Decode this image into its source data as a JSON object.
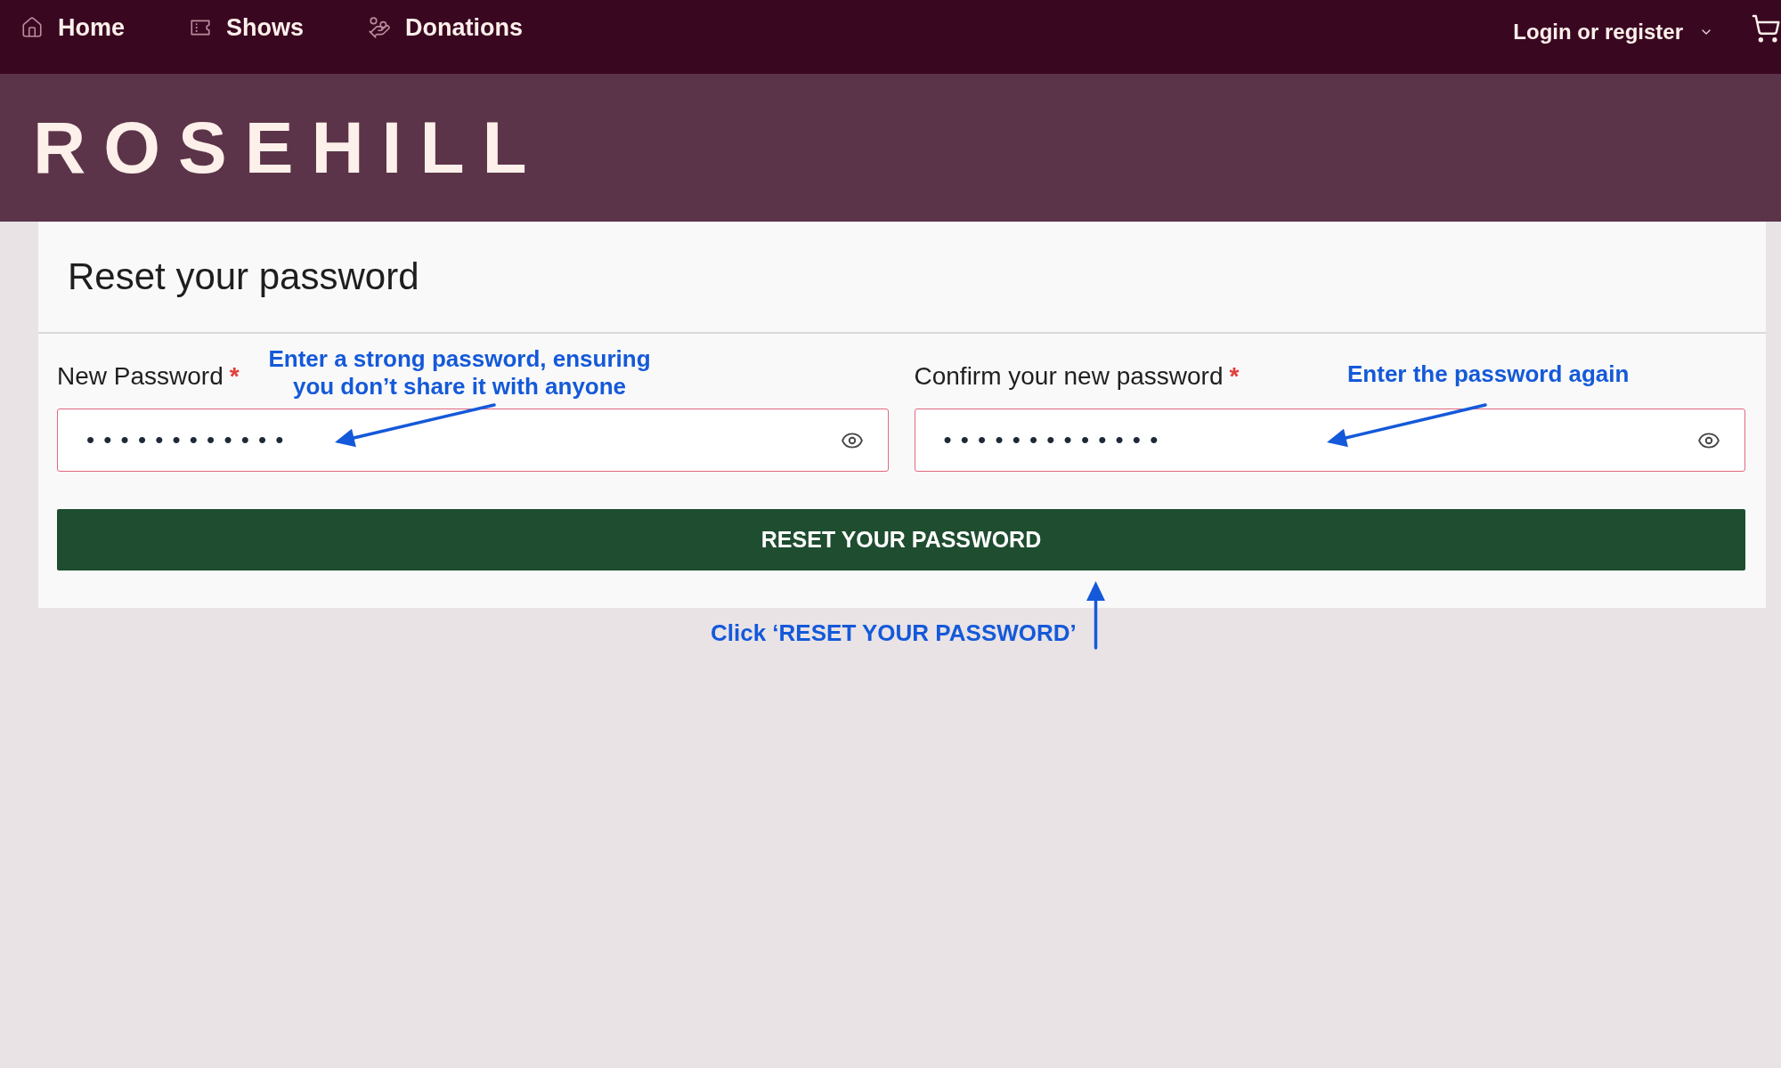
{
  "nav": {
    "items": [
      {
        "label": "Home"
      },
      {
        "label": "Shows"
      },
      {
        "label": "Donations"
      }
    ],
    "account_menu": {
      "label": "Login or register"
    }
  },
  "banner": {
    "logo": "ROSEHILL"
  },
  "form": {
    "title": "Reset your password",
    "fields": [
      {
        "label": "New Password",
        "required_mark": "*",
        "value": "••••••••••••"
      },
      {
        "label": "Confirm your new password",
        "required_mark": "*",
        "value": "•••••••••••••"
      }
    ],
    "submit_button": "RESET YOUR PASSWORD"
  },
  "annotations": [
    {
      "text": "Enter a strong password, ensuring you don’t share it with anyone"
    },
    {
      "text": "Enter the password again"
    },
    {
      "text": "Click ‘RESET YOUR PASSWORD’"
    }
  ]
}
